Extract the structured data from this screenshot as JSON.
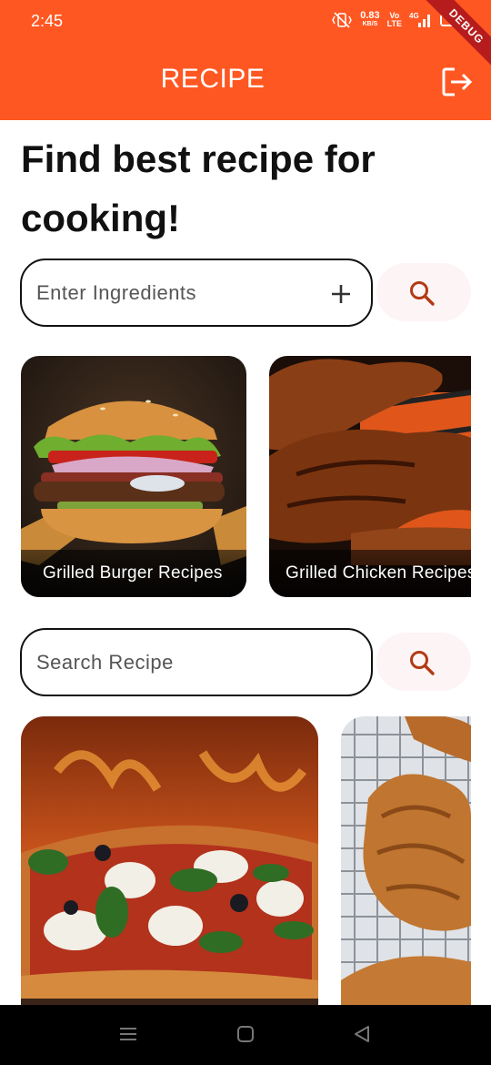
{
  "status": {
    "time": "2:45",
    "speed_value": "0.83",
    "speed_unit": "KB/S",
    "volte_top": "Vo",
    "volte_bottom": "LTE",
    "network": "4G",
    "debug_label": "DEBUG"
  },
  "appbar": {
    "title": "RECIPE",
    "logout_icon": "logout-icon"
  },
  "heading": "Find best recipe for cooking!",
  "ingredients_search": {
    "placeholder": "Enter Ingredients",
    "add_icon": "plus-icon",
    "search_icon": "search-icon"
  },
  "featured_recipes": [
    {
      "label": "Grilled Burger Recipes",
      "image": "burger-photo"
    },
    {
      "label": "Grilled Chicken Recipes",
      "image": "grilled-chicken-photo"
    }
  ],
  "recipe_search": {
    "placeholder": "Search Recipe",
    "search_icon": "search-icon"
  },
  "recipe_results": [
    {
      "image": "pizza-photo"
    },
    {
      "image": "fried-chicken-photo"
    }
  ],
  "colors": {
    "primary": "#ff5722",
    "search_icon": "#b23a14",
    "search_button_bg": "#fdf4f6",
    "text": "#111111"
  }
}
